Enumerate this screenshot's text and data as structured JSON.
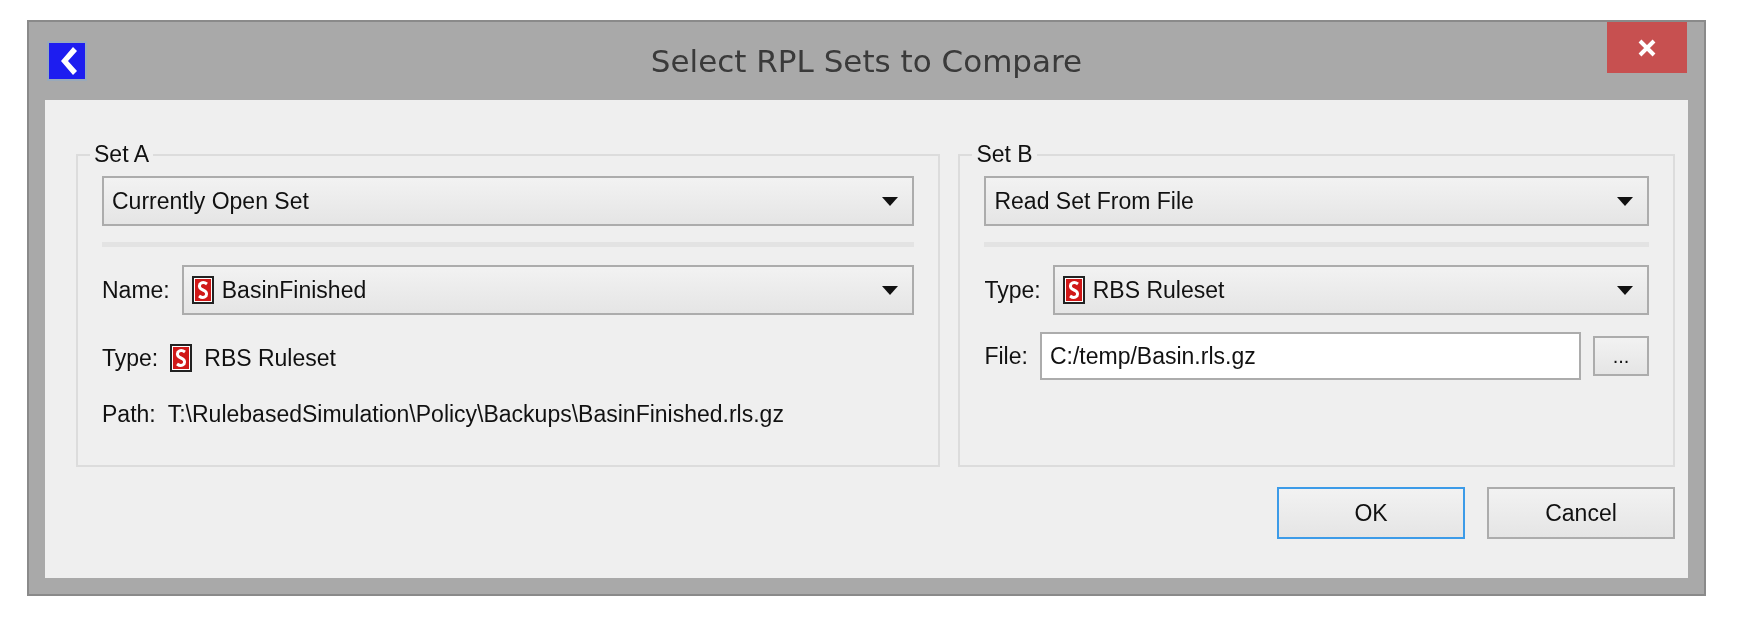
{
  "window": {
    "title": "Select RPL Sets to Compare"
  },
  "set_a": {
    "title": "Set A",
    "mode": "Currently Open Set",
    "name": {
      "label": "Name:",
      "value": "BasinFinished"
    },
    "type": {
      "label": "Type:",
      "value": "RBS Ruleset"
    },
    "path": {
      "label": "Path:",
      "value": "T:\\RulebasedSimulation\\Policy\\Backups\\BasinFinished.rls.gz"
    }
  },
  "set_b": {
    "title": "Set B",
    "mode": "Read Set From File",
    "type": {
      "label": "Type:",
      "value": "RBS Ruleset"
    },
    "file": {
      "label": "File:",
      "value": "C:/temp/Basin.rls.gz",
      "browse": "..."
    }
  },
  "buttons": [
    {
      "label": "OK",
      "focused": true
    },
    {
      "label": "Cancel",
      "focused": false
    }
  ]
}
